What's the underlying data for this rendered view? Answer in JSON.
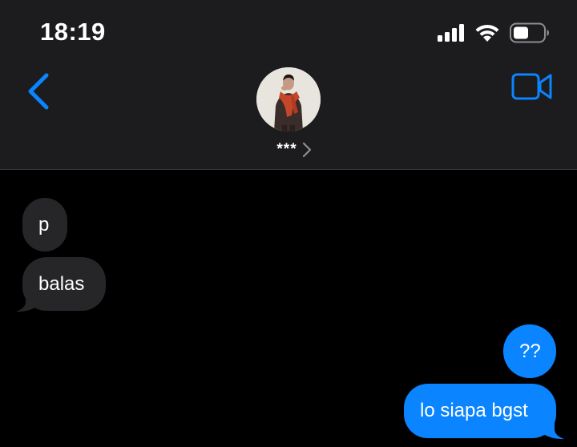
{
  "status_bar": {
    "time": "18:19",
    "icons": [
      "signal-bars-icon",
      "wifi-icon",
      "battery-icon"
    ]
  },
  "header": {
    "back_icon": "chevron-left-icon",
    "video_icon": "video-camera-icon",
    "contact_name": "***",
    "contact_chevron_icon": "chevron-right-icon"
  },
  "messages": [
    {
      "direction": "incoming",
      "text": "p"
    },
    {
      "direction": "incoming",
      "text": "balas"
    },
    {
      "direction": "outgoing",
      "text": "??"
    },
    {
      "direction": "outgoing",
      "text": "lo siapa bgst"
    }
  ],
  "colors": {
    "accent": "#0a84ff",
    "header_bg": "#1c1c1e",
    "incoming_bubble": "#262628",
    "outgoing_bubble": "#0a84ff",
    "background": "#000000"
  }
}
